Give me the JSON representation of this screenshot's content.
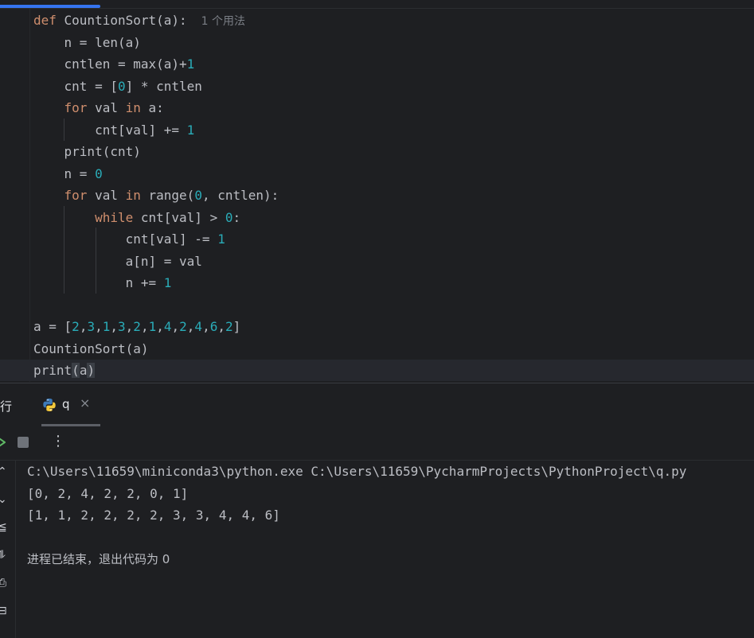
{
  "editor": {
    "lines": [
      {
        "tokens": [
          {
            "t": "def ",
            "c": "kw"
          },
          {
            "t": "CountionSort(a):",
            "c": ""
          }
        ],
        "hint": "1 个用法"
      },
      {
        "tokens": [
          {
            "t": "    n = len(a)",
            "c": ""
          }
        ]
      },
      {
        "tokens": [
          {
            "t": "    cntlen = max(a)+",
            "c": ""
          },
          {
            "t": "1",
            "c": "num"
          }
        ]
      },
      {
        "tokens": [
          {
            "t": "    cnt = [",
            "c": ""
          },
          {
            "t": "0",
            "c": "num"
          },
          {
            "t": "] * cntlen",
            "c": ""
          }
        ]
      },
      {
        "tokens": [
          {
            "t": "    ",
            "c": ""
          },
          {
            "t": "for",
            "c": "kw"
          },
          {
            "t": " val ",
            "c": ""
          },
          {
            "t": "in",
            "c": "kw"
          },
          {
            "t": " a:",
            "c": ""
          }
        ]
      },
      {
        "tokens": [
          {
            "t": "        cnt[val] += ",
            "c": ""
          },
          {
            "t": "1",
            "c": "num"
          }
        ]
      },
      {
        "tokens": [
          {
            "t": "    print(cnt)",
            "c": ""
          }
        ]
      },
      {
        "tokens": [
          {
            "t": "    n = ",
            "c": ""
          },
          {
            "t": "0",
            "c": "num"
          }
        ]
      },
      {
        "tokens": [
          {
            "t": "    ",
            "c": ""
          },
          {
            "t": "for",
            "c": "kw"
          },
          {
            "t": " val ",
            "c": ""
          },
          {
            "t": "in",
            "c": "kw"
          },
          {
            "t": " range(",
            "c": ""
          },
          {
            "t": "0",
            "c": "num"
          },
          {
            "t": ", cntlen):",
            "c": ""
          }
        ]
      },
      {
        "tokens": [
          {
            "t": "        ",
            "c": ""
          },
          {
            "t": "while",
            "c": "kw"
          },
          {
            "t": " cnt[val] > ",
            "c": ""
          },
          {
            "t": "0",
            "c": "num"
          },
          {
            "t": ":",
            "c": ""
          }
        ]
      },
      {
        "tokens": [
          {
            "t": "            cnt[val] -= ",
            "c": ""
          },
          {
            "t": "1",
            "c": "num"
          }
        ]
      },
      {
        "tokens": [
          {
            "t": "            a[n] = val",
            "c": ""
          }
        ]
      },
      {
        "tokens": [
          {
            "t": "            n += ",
            "c": ""
          },
          {
            "t": "1",
            "c": "num"
          }
        ]
      },
      {
        "tokens": []
      },
      {
        "tokens": [
          {
            "t": "a = [",
            "c": ""
          },
          {
            "t": "2",
            "c": "num"
          },
          {
            "t": ",",
            "c": ""
          },
          {
            "t": "3",
            "c": "num"
          },
          {
            "t": ",",
            "c": ""
          },
          {
            "t": "1",
            "c": "num"
          },
          {
            "t": ",",
            "c": ""
          },
          {
            "t": "3",
            "c": "num"
          },
          {
            "t": ",",
            "c": ""
          },
          {
            "t": "2",
            "c": "num"
          },
          {
            "t": ",",
            "c": ""
          },
          {
            "t": "1",
            "c": "num"
          },
          {
            "t": ",",
            "c": ""
          },
          {
            "t": "4",
            "c": "num"
          },
          {
            "t": ",",
            "c": ""
          },
          {
            "t": "2",
            "c": "num"
          },
          {
            "t": ",",
            "c": ""
          },
          {
            "t": "4",
            "c": "num"
          },
          {
            "t": ",",
            "c": ""
          },
          {
            "t": "6",
            "c": "num"
          },
          {
            "t": ",",
            "c": ""
          },
          {
            "t": "2",
            "c": "num"
          },
          {
            "t": "]",
            "c": ""
          }
        ]
      },
      {
        "tokens": [
          {
            "t": "CountionSort(a)",
            "c": ""
          }
        ]
      },
      {
        "tokens": [
          {
            "t": "print",
            "c": ""
          },
          {
            "t": "(",
            "c": "caret-hl"
          },
          {
            "t": "a",
            "c": ""
          },
          {
            "t": ")",
            "c": "caret-hl"
          }
        ]
      }
    ]
  },
  "toolwindow": {
    "label": "行",
    "tab_name": "q",
    "close_glyph": "×",
    "more_glyph": "⋮"
  },
  "side_icons": [
    "⌃",
    "⌄",
    "≦",
    "⥮",
    "⎙",
    "⊟"
  ],
  "console": {
    "lines": [
      "C:\\Users\\11659\\miniconda3\\python.exe C:\\Users\\11659\\PycharmProjects\\PythonProject\\q.py",
      "[0, 2, 4, 2, 2, 0, 1]",
      "[1, 1, 2, 2, 2, 2, 3, 3, 4, 4, 6]",
      "",
      "进程已结束，退出代码为 0"
    ]
  },
  "colors": {
    "keyword": "#cf8e6d",
    "number": "#2aacb8",
    "text": "#bcbec4",
    "background": "#1e1f22"
  }
}
